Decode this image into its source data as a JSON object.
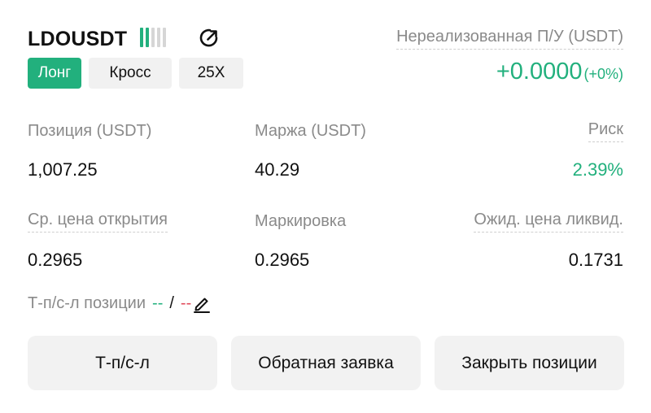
{
  "header": {
    "symbol": "LDOUSDT",
    "side": "Лонг",
    "margin_mode": "Кросс",
    "leverage": "25X"
  },
  "risk_bars": {
    "filled": 2,
    "total": 5,
    "active_color": "#22b07d",
    "inactive_color": "#d6d6d6"
  },
  "icons": {
    "share": "share-icon",
    "edit": "pencil-icon"
  },
  "pnl": {
    "label": "Нереализованная П/У (USDT)",
    "value": "+0.0000",
    "percent": "(+0%)"
  },
  "stats": {
    "position_label": "Позиция (USDT)",
    "position_value": "1,007.25",
    "margin_label": "Маржа (USDT)",
    "margin_value": "40.29",
    "risk_label": "Риск",
    "risk_value": "2.39%",
    "avg_open_label": "Ср. цена открытия",
    "avg_open_value": "0.2965",
    "mark_label": "Маркировка",
    "mark_value": "0.2965",
    "liq_label": "Ожид. цена ликвид.",
    "liq_value": "0.1731"
  },
  "tpsl": {
    "label": "Т-п/с-л позиции",
    "tp": "--",
    "separator": "/",
    "sl": "--"
  },
  "buttons": {
    "tpsl": "Т-п/с-л",
    "reverse": "Обратная заявка",
    "close": "Закрыть позиции"
  },
  "colors": {
    "accent_green": "#22b07d",
    "loss_red": "#e0485a"
  }
}
